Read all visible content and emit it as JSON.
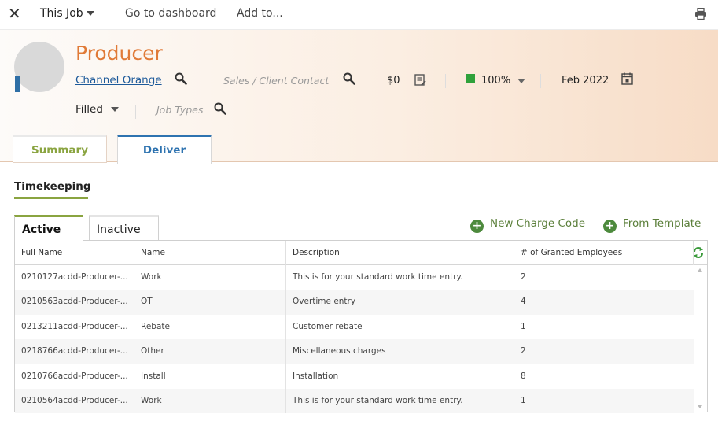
{
  "topbar": {
    "close_icon": "close-icon",
    "job_menu_label": "This Job",
    "dashboard_link": "Go to dashboard",
    "add_to_link": "Add to...",
    "print_icon": "print-icon"
  },
  "job": {
    "title": "Producer",
    "company": "Channel Orange",
    "contact_placeholder": "Sales / Client Contact",
    "amount": "$0",
    "probability": "100%",
    "status_color": "#2fa13b",
    "date": "Feb 2022",
    "status": "Filled",
    "job_types_placeholder": "Job Types"
  },
  "tabs": {
    "summary": "Summary",
    "deliver": "Deliver"
  },
  "timekeeping": {
    "title": "Timekeeping",
    "subtabs": {
      "active": "Active",
      "inactive": "Inactive"
    },
    "actions": {
      "new_charge_code": "New Charge Code",
      "from_template": "From Template"
    },
    "columns": [
      "Full Name",
      "Name",
      "Description",
      "# of Granted Employees"
    ],
    "rows": [
      [
        "0210127acdd-Producer-...",
        "Work",
        "This is for your standard work time entry.",
        "2"
      ],
      [
        "0210563acdd-Producer-...",
        "OT",
        "Overtime entry",
        "4"
      ],
      [
        "0213211acdd-Producer-...",
        "Rebate",
        "Customer rebate",
        "1"
      ],
      [
        "0218766acdd-Producer-...",
        "Other",
        "Miscellaneous charges",
        "2"
      ],
      [
        "0210766acdd-Producer-...",
        "Install",
        "Installation",
        "8"
      ],
      [
        "0210564acdd-Producer-...",
        "Work",
        "This is for your standard work time entry.",
        "1"
      ]
    ]
  },
  "colors": {
    "accent_orange": "#e07a37",
    "accent_green": "#8aa440",
    "accent_blue": "#2e73b0"
  }
}
